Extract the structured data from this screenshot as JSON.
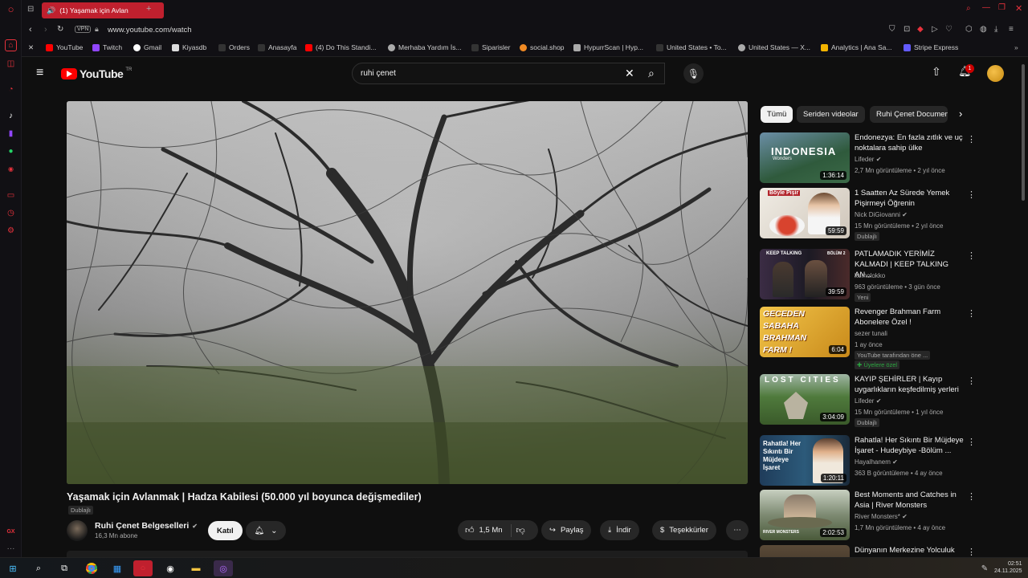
{
  "browser": {
    "tab_title": "(1) Yaşamak için Avlan",
    "vpn_label": "VPN",
    "url": "www.youtube.com/watch"
  },
  "bookmarks": [
    {
      "label": "YouTube",
      "color": "#ff0000"
    },
    {
      "label": "Twitch",
      "color": "#9146ff"
    },
    {
      "label": "Gmail",
      "color": "#ffffff"
    },
    {
      "label": "Kiyasdb",
      "color": "#dddddd"
    },
    {
      "label": "Orders",
      "color": "#555555"
    },
    {
      "label": "Anasayfa",
      "color": "#555555"
    },
    {
      "label": "(4) Do This Standi...",
      "color": "#ff0000"
    },
    {
      "label": "Merhaba Yardım İs...",
      "color": "#aaaaaa"
    },
    {
      "label": "Siparisler",
      "color": "#555555"
    },
    {
      "label": "social.shop",
      "color": "#f08a24"
    },
    {
      "label": "HypurrScan | Hyp...",
      "color": "#aaaaaa"
    },
    {
      "label": "United States • To...",
      "color": "#555555"
    },
    {
      "label": "United States — X...",
      "color": "#aaaaaa"
    },
    {
      "label": "Analytics | Ana Sa...",
      "color": "#f4b400"
    },
    {
      "label": "Stripe Express",
      "color": "#635bff"
    }
  ],
  "youtube": {
    "logo_text": "YouTube",
    "logo_region": "TR",
    "search_value": "ruhi çenet",
    "notification_count": "1"
  },
  "video": {
    "title": "Yaşamak için Avlanmak | Hadza Kabilesi (50.000 yıl boyunca değişmediler)",
    "dubbed_badge": "Dublajlı",
    "channel_name": "Ruhi Çenet Belgeselleri",
    "subscribers": "16,3 Mn abone",
    "join_label": "Katıl",
    "likes": "1,5 Mn",
    "share_label": "Paylaş",
    "download_label": "İndir",
    "thanks_label": "Teşekkürler"
  },
  "chips": [
    "Tümü",
    "Seriden videolar",
    "Ruhi Çenet Documen"
  ],
  "recommendations": [
    {
      "title": "Endonezya: En fazla zıtlık ve uç noktalara sahip ülke",
      "channel": "Lifeder",
      "verified": true,
      "meta": "2,7 Mn görüntüleme • 2 yıl önce",
      "badge": "",
      "duration": "1:36:14",
      "thumb_text": "INDONESIA",
      "thumb_sub": "Wonders",
      "thumb_color": "#3a6b8f"
    },
    {
      "title": "1 Saatten Az Sürede Yemek Pişirmeyi Öğrenin",
      "channel": "Nick DiGiovanni",
      "verified": true,
      "meta": "15 Mn görüntüleme • 2 yıl önce",
      "badge": "Dublajlı",
      "duration": "59:59",
      "thumb_text": "Böyle Pişir",
      "thumb_sub": "",
      "thumb_color": "#d9d4cc"
    },
    {
      "title": "PATLAMADIK YERİMİZ KALMADI | KEEP TALKING AN...",
      "channel": "kemolokko",
      "verified": false,
      "meta": "963 görüntüleme • 3 gün önce",
      "badge": "Yeni",
      "duration": "39:59",
      "thumb_text": "KEEP TALKING",
      "thumb_sub": "BÖLÜM 2",
      "thumb_color": "#2a2530"
    },
    {
      "title": "Revenger Brahman Farm Abonelere Özel !",
      "channel": "sezer tunali",
      "verified": false,
      "meta": "1 ay önce",
      "badge": "YouTube tarafından öne ...",
      "members": "Üyelere özel",
      "duration": "6:04",
      "thumb_text": "GECEDEN SABAHA BRAHMAN FARM !",
      "thumb_sub": "",
      "thumb_color": "#e2a72a"
    },
    {
      "title": "KAYIP ŞEHİRLER | Kayıp uygarlıkların keşfedilmiş yerleri",
      "channel": "Lifeder",
      "verified": true,
      "meta": "15 Mn görüntüleme • 1 yıl önce",
      "badge": "Dublajlı",
      "duration": "3:04:09",
      "thumb_text": "LOST CITIES",
      "thumb_sub": "",
      "thumb_color": "#4f7a3c"
    },
    {
      "title": "Rahatla! Her Sıkıntı Bir Müjdeye İşaret - Hudeybiye -Bölüm ...",
      "channel": "Hayalhanem",
      "verified": true,
      "meta": "363 B görüntüleme • 4 ay önce",
      "badge": "",
      "duration": "1:20:11",
      "thumb_text": "Rahatla! Her Sıkıntı Bir Müjdeye İşaret",
      "thumb_sub": "",
      "thumb_color": "#23415e"
    },
    {
      "title": "Best Moments and Catches in Asia | River Monsters",
      "channel": "River Monsters*",
      "verified": true,
      "meta": "1,7 Mn görüntüleme • 4 ay önce",
      "badge": "",
      "duration": "2:02:53",
      "thumb_text": "RIVER MONSTERS",
      "thumb_sub": "",
      "thumb_color": "#7d8a72"
    },
    {
      "title": "Dünyanın Merkezine Yolculuk",
      "channel": "",
      "verified": false,
      "meta": "",
      "badge": "",
      "duration": "",
      "thumb_text": "",
      "thumb_sub": "",
      "thumb_color": "#3a3228"
    }
  ],
  "taskbar": {
    "time": "02:51",
    "date": "24.11.2025"
  },
  "opera": {
    "gx_label": "GX"
  }
}
